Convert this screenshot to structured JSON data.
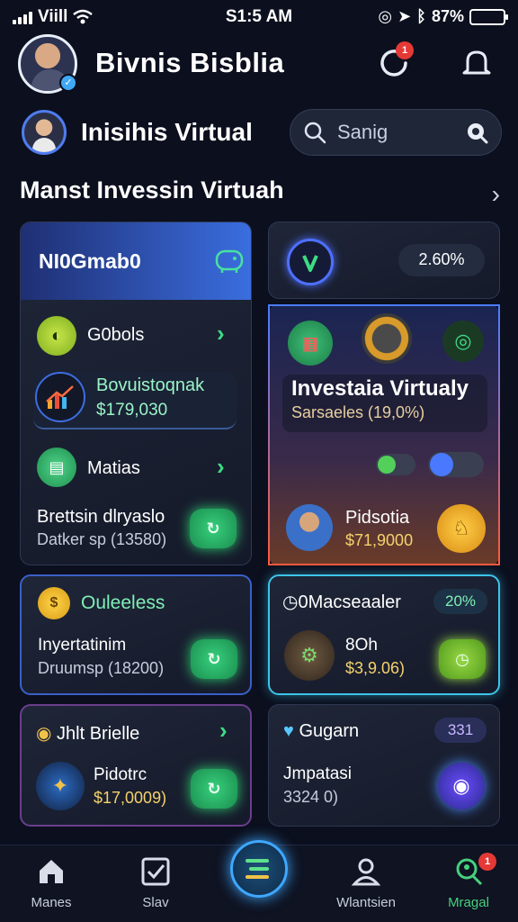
{
  "status_bar": {
    "carrier": "Viill",
    "time": "S1:5 AM",
    "battery_pct": "87%"
  },
  "header": {
    "title": "Bivnis Bisblia",
    "notification_count": "1"
  },
  "profile": {
    "name": "Inisihis Virtual"
  },
  "search": {
    "placeholder": "Sanig"
  },
  "section": {
    "title": "Manst Invessin Virtuah"
  },
  "cards": {
    "nio": {
      "title": "NI0Gmab0"
    },
    "stat": {
      "value": "2.60%"
    },
    "left_list": {
      "item1": {
        "label": "G0bols"
      },
      "invest": {
        "title": "Bovuistoqnak",
        "value": "$179,030"
      },
      "item2": {
        "label": "Matias"
      },
      "bottom": {
        "title": "Brettsin dlryaslo",
        "subtitle": "Datker sp (13580)"
      }
    },
    "featured": {
      "title": "Investaia Virtualy",
      "subtitle": "Sarsaeles (19,0%)",
      "person": "Pidsotia",
      "amount": "$71,9000"
    },
    "ouleeless": {
      "title": "Ouleeless",
      "item": "Inyertatinim",
      "amount": "Druumsp (18200)"
    },
    "macseaaler": {
      "title": "0Macseaaler",
      "badge": "20%",
      "line1": "8Oh",
      "line2": "$3,9.06)"
    },
    "jhlt": {
      "title": "Jhlt Brielle",
      "item": "Pidotrc",
      "amount": "$17,0009)"
    },
    "gugarn": {
      "title": "Gugarn",
      "badge": "331",
      "item": "Jmpatasi",
      "amount": "3324 0)"
    }
  },
  "nav": {
    "items": [
      {
        "label": "Manes",
        "icon": "home-icon"
      },
      {
        "label": "Slav",
        "icon": "checkbox-icon"
      },
      {
        "label": "Wlantsien",
        "icon": "user-icon"
      },
      {
        "label": "Mragal",
        "icon": "search-user-icon",
        "badge": "1"
      }
    ]
  },
  "colors": {
    "accent_blue": "#3ea8ff",
    "accent_green": "#3ddc84",
    "background": "#0b0f1e"
  }
}
